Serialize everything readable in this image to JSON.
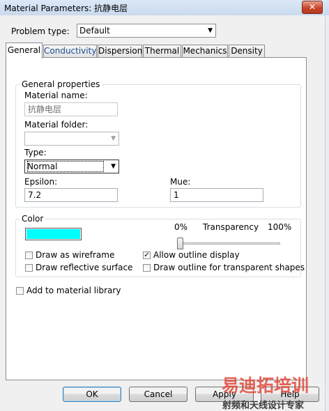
{
  "window": {
    "title": "Material Parameters: 抗静电层",
    "close_glyph": "✕"
  },
  "problem_type": {
    "label": "Problem type:",
    "value": "Default"
  },
  "tabs": [
    {
      "label": "General",
      "active": true
    },
    {
      "label": "Conductivity",
      "active": false
    },
    {
      "label": "Dispersion",
      "active": false
    },
    {
      "label": "Thermal",
      "active": false
    },
    {
      "label": "Mechanics",
      "active": false
    },
    {
      "label": "Density",
      "active": false
    }
  ],
  "general_properties": {
    "group_title": "General properties",
    "material_name_label": "Material name:",
    "material_name_value": "抗静电层",
    "material_folder_label": "Material folder:",
    "material_folder_value": "",
    "type_label": "Type:",
    "type_value": "Normal",
    "epsilon_label": "Epsilon:",
    "epsilon_value": "7.2",
    "mue_label": "Mue:",
    "mue_value": "1"
  },
  "color": {
    "group_title": "Color",
    "swatch": "#00ffff",
    "transparency_label": "Transparency",
    "transparency_min": "0%",
    "transparency_max": "100%",
    "transparency_level": 0,
    "draw_as_wireframe": {
      "label": "Draw as wireframe",
      "checked": false
    },
    "allow_outline_display": {
      "label": "Allow outline display",
      "checked": true
    },
    "draw_reflective_surface": {
      "label": "Draw reflective surface",
      "checked": false
    },
    "draw_outline_transparent": {
      "label": "Draw outline for transparent shapes",
      "checked": false
    }
  },
  "add_to_library": {
    "label": "Add to material library",
    "checked": false
  },
  "buttons": {
    "ok": "OK",
    "cancel": "Cancel",
    "apply": "Apply",
    "help": "Help"
  },
  "watermark": {
    "line1": "易迪拓培训",
    "line2": "射频和天线设计专家",
    "color1": "#e24a3b",
    "color2": "#3a3a3a"
  },
  "icons": {
    "checkmark": "✓",
    "dropdown": "▼"
  }
}
